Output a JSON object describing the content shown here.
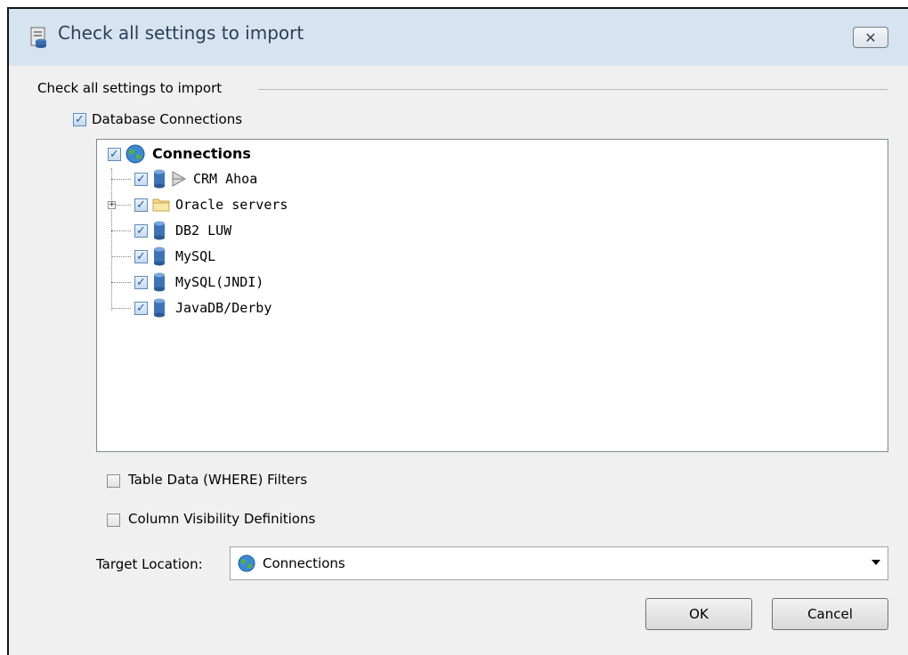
{
  "window": {
    "title": "Check all settings to import",
    "app_icon": "settings-import-icon",
    "close_icon": "close-icon"
  },
  "group": {
    "label": "Check all settings to import"
  },
  "options": {
    "database_connections": {
      "label": "Database Connections",
      "checked": true
    },
    "table_filters": {
      "label": "Table Data (WHERE) Filters",
      "checked": false
    },
    "column_visibility": {
      "label": "Column Visibility Definitions",
      "checked": false
    }
  },
  "tree": {
    "root": {
      "label": "Connections",
      "icon": "globe-icon",
      "checked": true
    },
    "items": [
      {
        "label": "CRM Ahoa",
        "icon": "database-icon",
        "extra_icon": "connection-icon",
        "checked": true
      },
      {
        "label": "Oracle servers",
        "icon": "folder-icon",
        "checked": true,
        "expandable": true
      },
      {
        "label": "DB2 LUW",
        "icon": "database-icon",
        "checked": true
      },
      {
        "label": "MySQL",
        "icon": "database-icon",
        "checked": true
      },
      {
        "label": "MySQL(JNDI)",
        "icon": "database-icon",
        "checked": true
      },
      {
        "label": "JavaDB/Derby",
        "icon": "database-icon",
        "checked": true
      }
    ]
  },
  "target": {
    "label": "Target Location:",
    "value": "Connections",
    "icon": "globe-icon"
  },
  "buttons": {
    "ok": "OK",
    "cancel": "Cancel"
  },
  "colors": {
    "titlebar": "#d6e4f1",
    "dialog_bg": "#f0f0f0",
    "check_accent": "#1e5fb4"
  }
}
